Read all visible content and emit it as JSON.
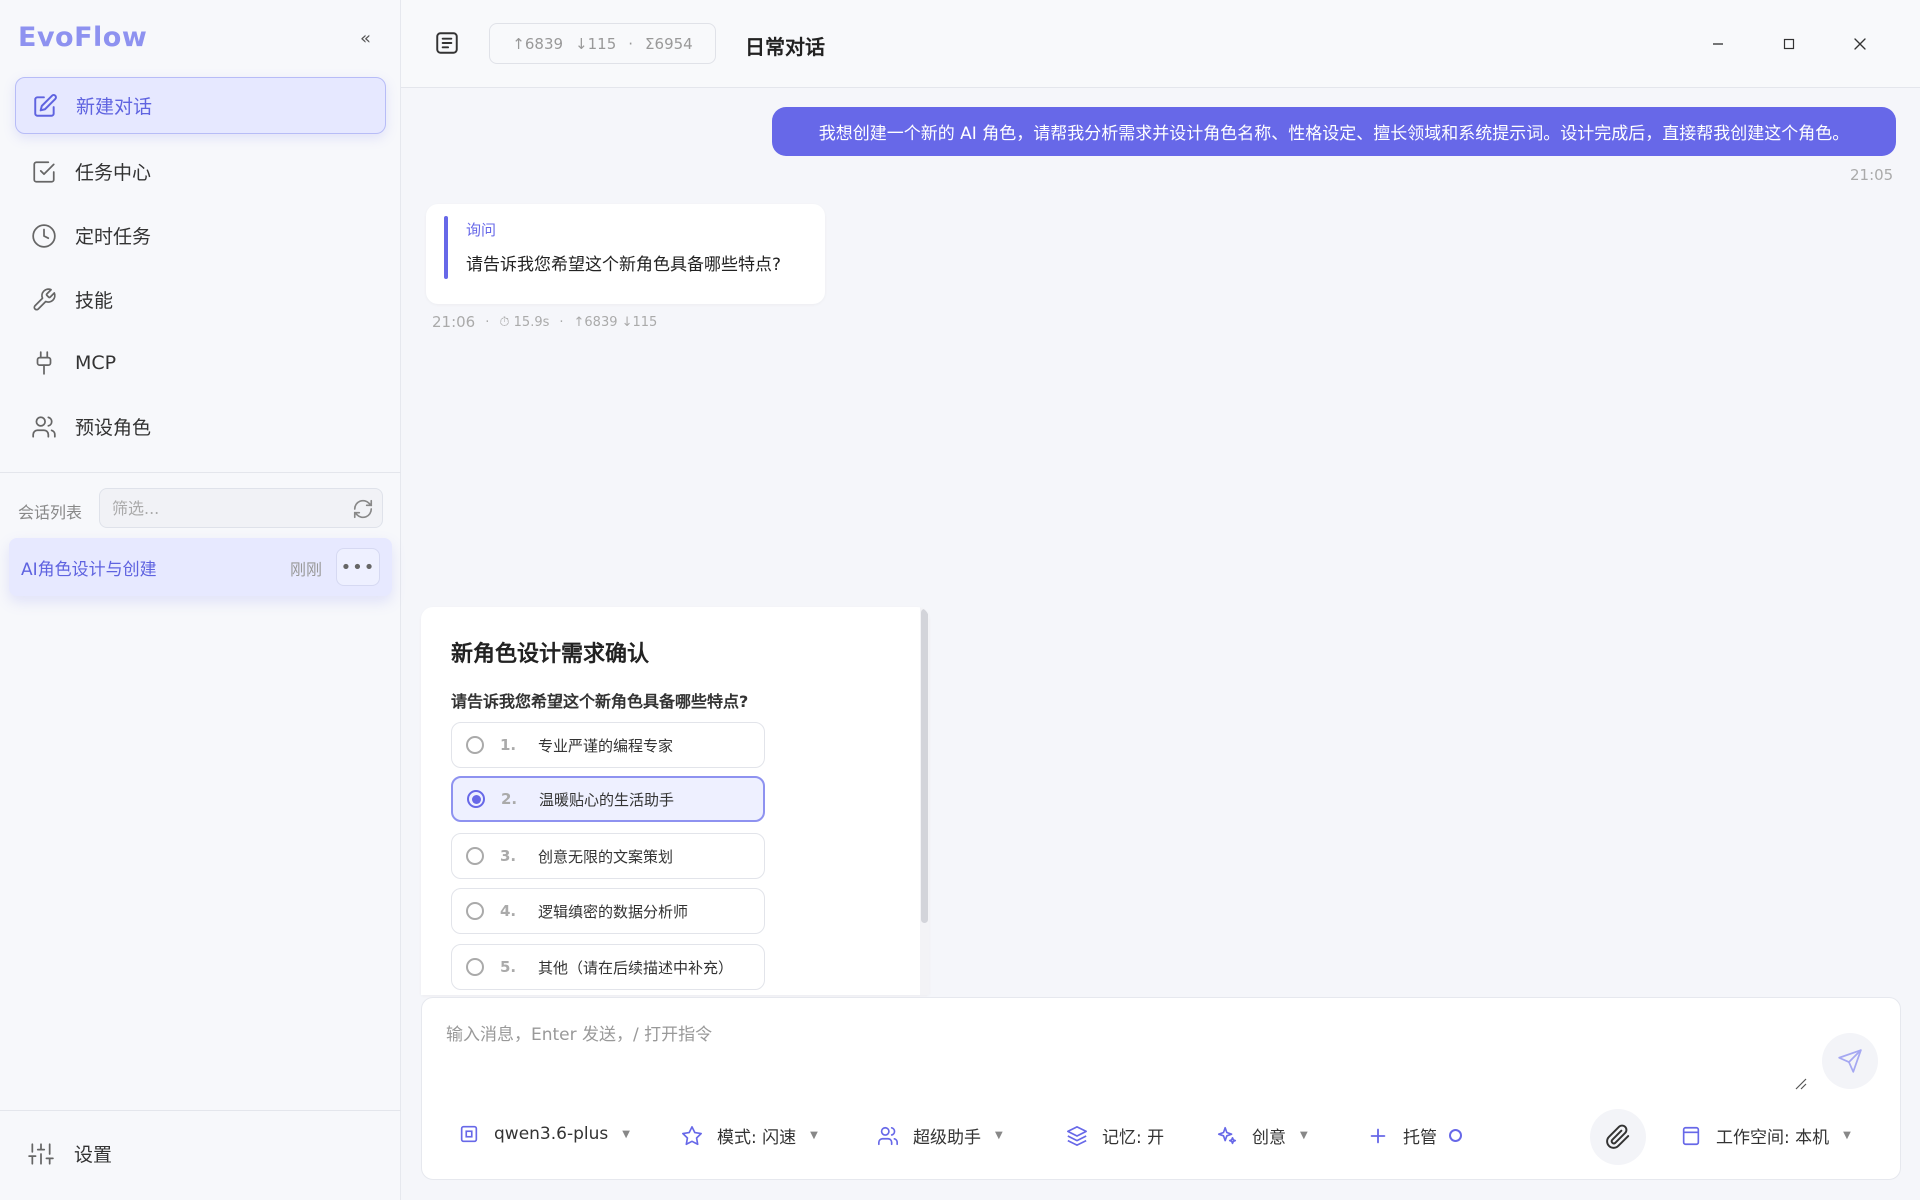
{
  "app": {
    "name": "EvoFlow",
    "collapse_icon": "«"
  },
  "nav": [
    {
      "label": "新建对话",
      "icon": "edit-icon",
      "active": true
    },
    {
      "label": "任务中心",
      "icon": "checkbox-icon",
      "active": false
    },
    {
      "label": "定时任务",
      "icon": "clock-icon",
      "active": false
    },
    {
      "label": "技能",
      "icon": "wrench-icon",
      "active": false
    },
    {
      "label": "MCP",
      "icon": "plug-icon",
      "active": false
    },
    {
      "label": "预设角色",
      "icon": "users-icon",
      "active": false
    }
  ],
  "sessions": {
    "label": "会话列表",
    "filter_placeholder": "筛选...",
    "items": [
      {
        "title": "AI角色设计与创建",
        "time": "刚刚",
        "more": "•••"
      }
    ]
  },
  "settings_label": "设置",
  "header": {
    "tokens": {
      "up": "6839",
      "down": "115",
      "sep": "·",
      "sum": "6954"
    },
    "title": "日常对话",
    "window_controls": [
      "minimize",
      "maximize",
      "close"
    ]
  },
  "chat": {
    "user_message": "我想创建一个新的 AI 角色，请帮我分析需求并设计角色名称、性格设定、擅长领域和系统提示词。设计完成后，直接帮我创建这个角色。",
    "user_time": "21:05",
    "ask": {
      "label": "询问",
      "text": "请告诉我您希望这个新角色具备哪些特点?"
    },
    "meta": {
      "time": "21:06",
      "sep": "·",
      "duration": "15.9s",
      "tokens": "↑6839 ↓115"
    }
  },
  "question_panel": {
    "title": "新角色设计需求确认",
    "question": "请告诉我您希望这个新角色具备哪些特点?",
    "options": [
      {
        "num": "1.",
        "label": "专业严谨的编程专家",
        "selected": false
      },
      {
        "num": "2.",
        "label": "温暖贴心的生活助手",
        "selected": true
      },
      {
        "num": "3.",
        "label": "创意无限的文案策划",
        "selected": false
      },
      {
        "num": "4.",
        "label": "逻辑缜密的数据分析师",
        "selected": false
      },
      {
        "num": "5.",
        "label": "其他（请在后续描述中补充）",
        "selected": false
      }
    ]
  },
  "composer": {
    "placeholder": "输入消息，Enter 发送，/ 打开指令",
    "model": "qwen3.6-plus",
    "mode": "模式: 闪速",
    "agent": "超级助手",
    "memory": "记忆: 开",
    "creative": "创意",
    "managed": "托管",
    "workspace": "工作空间: 本机"
  },
  "colors": {
    "accent": "#6768e8",
    "brand": "#8e92f0",
    "active_bg": "#e6e8ff"
  }
}
